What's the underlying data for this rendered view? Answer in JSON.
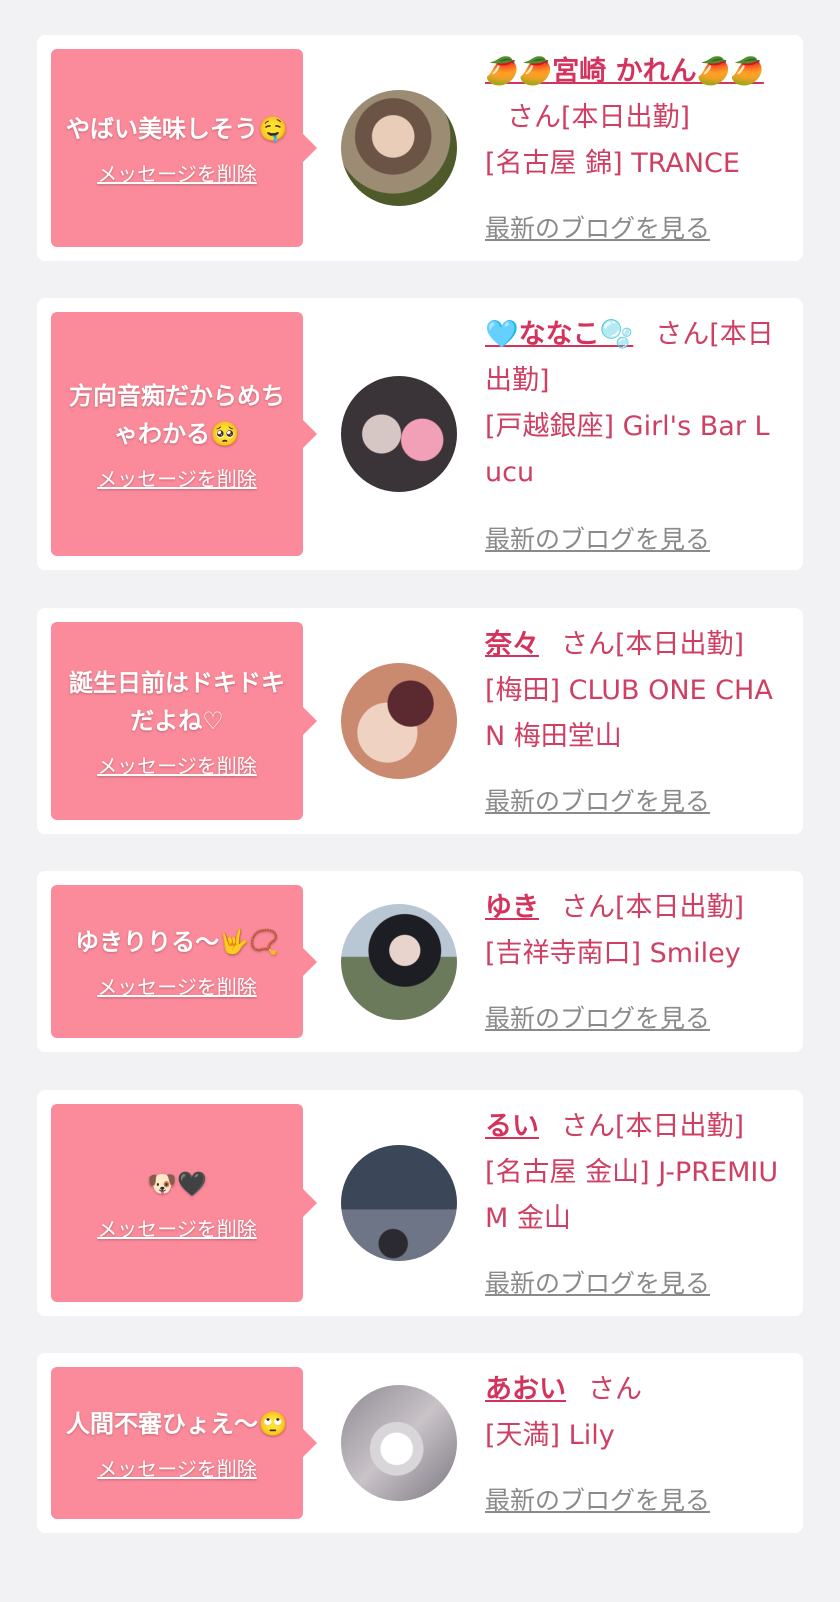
{
  "cards": [
    {
      "message": "やばい美味しそう🤤",
      "delete_label": "メッセージを削除",
      "name": "🥭🥭宮崎 かれん🥭🥭",
      "suffix": "さん[本日出勤]",
      "shop": "[名古屋 錦] TRANCE",
      "blog_label": "最新のブログを見る"
    },
    {
      "message": "方向音痴だからめちゃわかる🥺",
      "delete_label": "メッセージを削除",
      "name": "🩵ななこ🫧",
      "suffix": "さん[本日出勤]",
      "shop": "[戸越銀座] Girl's Bar Lucu",
      "blog_label": "最新のブログを見る"
    },
    {
      "message": "誕生日前はドキドキだよね♡",
      "delete_label": "メッセージを削除",
      "name": "奈々",
      "suffix": "さん[本日出勤]",
      "shop": "[梅田] CLUB ONE CHAN 梅田堂山",
      "blog_label": "最新のブログを見る"
    },
    {
      "message": "ゆきりりる〜🤟📿",
      "delete_label": "メッセージを削除",
      "name": "ゆき",
      "suffix": "さん[本日出勤]",
      "shop": "[吉祥寺南口] Smiley",
      "blog_label": "最新のブログを見る"
    },
    {
      "message": "🐶🖤",
      "delete_label": "メッセージを削除",
      "name": "るい",
      "suffix": "さん[本日出勤]",
      "shop": "[名古屋 金山] J-PREMIUM 金山",
      "blog_label": "最新のブログを見る"
    },
    {
      "message": "人間不審ひょえ〜🙄",
      "delete_label": "メッセージを削除",
      "name": "あおい",
      "suffix": "さん",
      "shop": "[天満] Lily",
      "blog_label": "最新のブログを見る"
    }
  ],
  "colors": {
    "background": "#f2f2f4",
    "bubble": "#fb8a9a",
    "name": "#d3335c",
    "shop_text": "#cf3f63",
    "blog_link": "#8a8a8a"
  }
}
